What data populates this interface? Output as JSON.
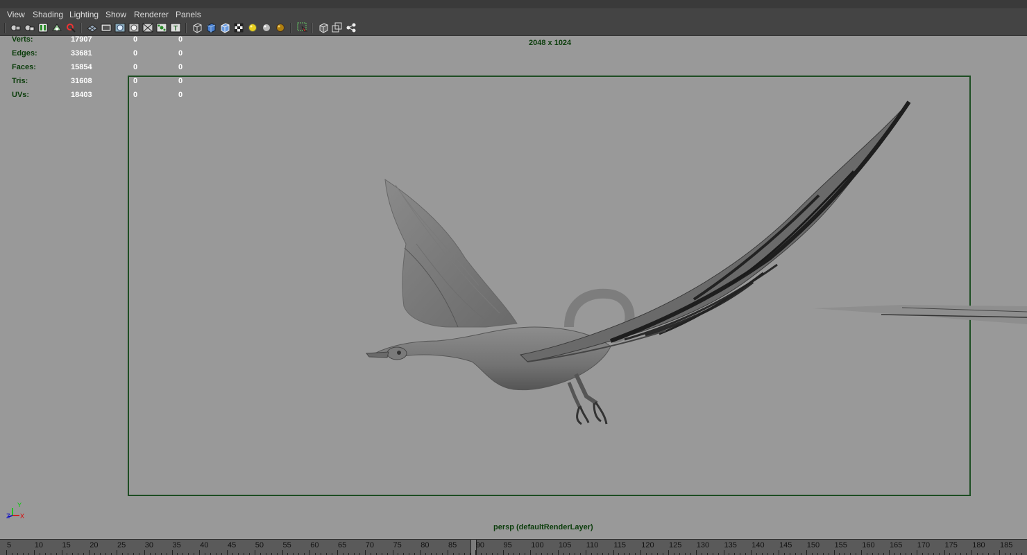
{
  "menu": [
    "View",
    "Shading",
    "Lighting",
    "Show",
    "Renderer",
    "Panels"
  ],
  "toolbar_icons": [
    "select-camera-icon",
    "lock-camera-icon",
    "camera-attributes-icon",
    "bookmark-icon",
    "image-plane-icon",
    "grid-icon",
    "film-gate-icon",
    "resolution-gate-icon",
    "gate-mask-icon",
    "field-chart-icon",
    "safe-action-icon",
    "safe-title-icon",
    "wireframe-icon",
    "smooth-shade-icon",
    "wireframe-on-shaded-icon",
    "textured-icon",
    "use-all-lights-icon",
    "shadows-icon",
    "ambient-occlusion-icon",
    "isolate-select-icon",
    "xray-icon",
    "xray-joints-icon",
    "xray-components-icon"
  ],
  "hud": {
    "rows": [
      {
        "label": "Verts:",
        "value": "17907",
        "col2": "0",
        "col3": "0"
      },
      {
        "label": "Edges:",
        "value": "33681",
        "col2": "0",
        "col3": "0"
      },
      {
        "label": "Faces:",
        "value": "15854",
        "col2": "0",
        "col3": "0"
      },
      {
        "label": "Tris:",
        "value": "31608",
        "col2": "0",
        "col3": "0"
      },
      {
        "label": "UVs:",
        "value": "18403",
        "col2": "0",
        "col3": "0"
      }
    ],
    "resolution": "2048 x 1024",
    "camera": "persp (defaultRenderLayer)",
    "axis": {
      "y": "Y",
      "z": "Z",
      "x": "X"
    }
  },
  "timeline": {
    "labels": [
      "5",
      "10",
      "15",
      "20",
      "25",
      "30",
      "35",
      "40",
      "45",
      "50",
      "55",
      "60",
      "65",
      "70",
      "75",
      "80",
      "85",
      "90",
      "95",
      "100",
      "105",
      "110",
      "115",
      "120",
      "125",
      "130",
      "135",
      "140",
      "145",
      "150",
      "155",
      "160",
      "165",
      "170",
      "175",
      "180",
      "185"
    ],
    "current_frame": "90"
  },
  "colors": {
    "hud_label": "#0b3d0b",
    "hud_value": "#ffffff",
    "viewport_bg": "#999999",
    "gate": "#1d4d22"
  }
}
